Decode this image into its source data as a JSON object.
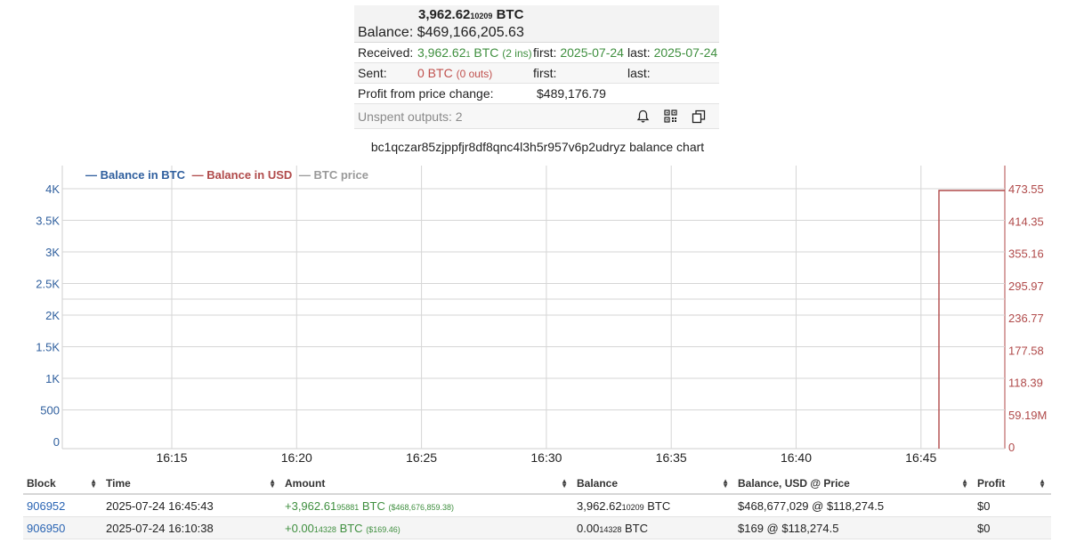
{
  "summary": {
    "balance_btc_main": "3,962.62",
    "balance_btc_small": "10209",
    "balance_btc_unit": "BTC",
    "balance_label": "Balance:",
    "balance_usd": "$469,166,205.63",
    "received_label": "Received:",
    "received_main": "3,962.62",
    "received_small": "1",
    "received_unit": "BTC",
    "received_ins": "(2 ins)",
    "received_first_label": "first:",
    "received_first": "2025-07-24",
    "received_last_label": "last:",
    "received_last": "2025-07-24",
    "sent_label": "Sent:",
    "sent_value": "0 BTC",
    "sent_outs": "(0 outs)",
    "sent_first_label": "first:",
    "sent_last_label": "last:",
    "profit_label": "Profit from price change:",
    "profit_value": "$489,176.79",
    "unspent_label": "Unspent outputs: 2",
    "icons": [
      "bell-icon",
      "qr-code-icon",
      "copy-icon"
    ]
  },
  "chart": {
    "title": "bc1qczar85zjppfjr8df8qnc4l3h5r957v6p2udryz balance chart",
    "legend": [
      {
        "label": "— Balance in BTC",
        "color": "#2f5f9e"
      },
      {
        "label": "— Balance in USD",
        "color": "#b04a4a"
      },
      {
        "label": "— BTC price",
        "color": "#999999"
      }
    ]
  },
  "chart_data": {
    "type": "line",
    "x_ticks": [
      "16:15",
      "16:20",
      "16:25",
      "16:30",
      "16:35",
      "16:40",
      "16:45"
    ],
    "y_left_ticks": [
      "0",
      "500",
      "1K",
      "1.5K",
      "2K",
      "2.5K",
      "3K",
      "3.5K",
      "4K"
    ],
    "y_left_range": [
      0,
      4000
    ],
    "y_right_ticks": [
      "0",
      "59.19M",
      "118.39",
      "177.58",
      "236.77",
      "295.97",
      "355.16",
      "414.35",
      "473.55"
    ],
    "y_right_range": [
      0,
      473550000
    ],
    "series": [
      {
        "name": "Balance in USD",
        "axis": "right",
        "color": "#b04a4a",
        "points": [
          [
            "16:10:38",
            169
          ],
          [
            "16:45:43",
            169
          ],
          [
            "16:45:43",
            468677029
          ],
          [
            "16:48:30",
            468677029
          ]
        ]
      }
    ]
  },
  "table": {
    "headers": [
      "Block",
      "Time",
      "Amount",
      "Balance",
      "Balance, USD @ Price",
      "Profit"
    ],
    "rows": [
      {
        "block": "906952",
        "time": "2025-07-24 16:45:43",
        "amount_main": "+3,962.61",
        "amount_small": "95881",
        "amount_unit": "BTC",
        "amount_usd": "($468,676,859.38)",
        "balance_main": "3,962.62",
        "balance_small": "10209",
        "balance_unit": "BTC",
        "balance_usd": "$468,677,029 @ $118,274.5",
        "profit": "$0"
      },
      {
        "block": "906950",
        "time": "2025-07-24 16:10:38",
        "amount_main": "+0.00",
        "amount_small": "14328",
        "amount_unit": "BTC",
        "amount_usd": "($169.46)",
        "balance_main": "0.00",
        "balance_small": "14328",
        "balance_unit": "BTC",
        "balance_usd": "$169 @ $118,274.5",
        "profit": "$0"
      }
    ]
  }
}
